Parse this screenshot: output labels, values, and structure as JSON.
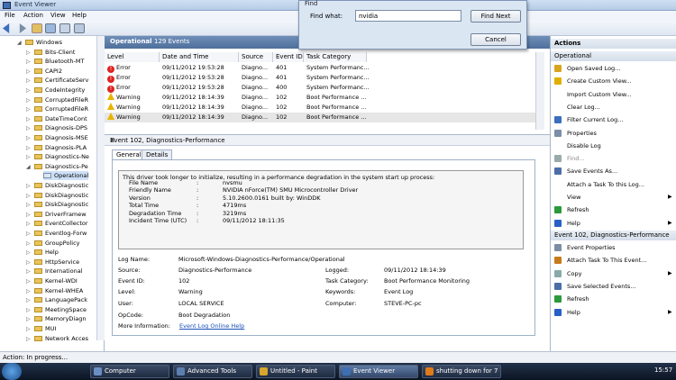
{
  "window": {
    "title": "Event Viewer"
  },
  "menu": [
    "File",
    "Action",
    "View",
    "Help"
  ],
  "tree": {
    "items": [
      {
        "label": "Windows",
        "level": 0,
        "expanded": true
      },
      {
        "label": "Bits-Client",
        "level": 1
      },
      {
        "label": "Bluetooth-MT",
        "level": 1
      },
      {
        "label": "CAPI2",
        "level": 1
      },
      {
        "label": "CertificateServ",
        "level": 1
      },
      {
        "label": "CodeIntegrity",
        "level": 1
      },
      {
        "label": "CorruptedFileR",
        "level": 1
      },
      {
        "label": "CorruptedFileR",
        "level": 1
      },
      {
        "label": "DateTimeCont",
        "level": 1
      },
      {
        "label": "Diagnosis-DPS",
        "level": 1
      },
      {
        "label": "Diagnosis-MSE",
        "level": 1
      },
      {
        "label": "Diagnosis-PLA",
        "level": 1
      },
      {
        "label": "Diagnostics-Ne",
        "level": 1
      },
      {
        "label": "Diagnostics-Pe",
        "level": 1,
        "expanded": true
      },
      {
        "label": "Operational",
        "level": 2,
        "selected": true
      },
      {
        "label": "DiskDiagnostic",
        "level": 1
      },
      {
        "label": "DiskDiagnostic",
        "level": 1
      },
      {
        "label": "DiskDiagnostic",
        "level": 1
      },
      {
        "label": "DriverFramew",
        "level": 1
      },
      {
        "label": "EventCollector",
        "level": 1
      },
      {
        "label": "Eventlog-Forw",
        "level": 1
      },
      {
        "label": "GroupPolicy",
        "level": 1
      },
      {
        "label": "Help",
        "level": 1
      },
      {
        "label": "HttpService",
        "level": 1
      },
      {
        "label": "International",
        "level": 1
      },
      {
        "label": "Kernel-WDI",
        "level": 1
      },
      {
        "label": "Kernel-WHEA",
        "level": 1
      },
      {
        "label": "LanguagePack",
        "level": 1
      },
      {
        "label": "MeetingSpace",
        "level": 1
      },
      {
        "label": "MemoryDiagn",
        "level": 1
      },
      {
        "label": "MUI",
        "level": 1
      },
      {
        "label": "Network Acces",
        "level": 1
      }
    ]
  },
  "log": {
    "name": "Operational",
    "count": "129 Events"
  },
  "columns": [
    "Level",
    "Date and Time",
    "Source",
    "Event ID",
    "Task Category"
  ],
  "events": [
    {
      "level": "Error",
      "type": "error",
      "date": "09/11/2012 19:53:28",
      "source": "Diagno...",
      "id": "401",
      "task": "System Performanc..."
    },
    {
      "level": "Error",
      "type": "error",
      "date": "09/11/2012 19:53:28",
      "source": "Diagno...",
      "id": "401",
      "task": "System Performanc..."
    },
    {
      "level": "Error",
      "type": "error",
      "date": "09/11/2012 19:53:28",
      "source": "Diagno...",
      "id": "400",
      "task": "System Performanc..."
    },
    {
      "level": "Warning",
      "type": "warning",
      "date": "09/11/2012 18:14:39",
      "source": "Diagno...",
      "id": "102",
      "task": "Boot Performance ..."
    },
    {
      "level": "Warning",
      "type": "warning",
      "date": "09/11/2012 18:14:39",
      "source": "Diagno...",
      "id": "102",
      "task": "Boot Performance ..."
    },
    {
      "level": "Warning",
      "type": "warning",
      "date": "09/11/2012 18:14:39",
      "source": "Diagno...",
      "id": "102",
      "task": "Boot Performance ..."
    }
  ],
  "detail": {
    "title": "Event 102, Diagnostics-Performance",
    "tabs": [
      "General",
      "Details"
    ],
    "description": "This driver took longer to initialize, resulting in a performance degradation in the system start up process:",
    "fields": [
      {
        "k": "File Name",
        "v": "nvsmu"
      },
      {
        "k": "Friendly Name",
        "v": "NVIDIA nForce(TM) SMU Microcontroller Driver"
      },
      {
        "k": "Version",
        "v": "5.10.2600.0161 built by: WinDDK"
      },
      {
        "k": "Total Time",
        "v": "4719ms"
      },
      {
        "k": "Degradation Time",
        "v": "3219ms"
      },
      {
        "k": "Incident Time (UTC)",
        "v": "09/11/2012 18:11:35"
      }
    ],
    "log_name_label": "Log Name:",
    "log_name": "Microsoft-Windows-Diagnostics-Performance/Operational",
    "source_label": "Source:",
    "source": "Diagnostics-Performance",
    "logged_label": "Logged:",
    "logged": "09/11/2012 18:14:39",
    "event_id_label": "Event ID:",
    "event_id": "102",
    "task_label": "Task Category:",
    "task": "Boot Performance Monitoring",
    "level_label": "Level:",
    "level": "Warning",
    "keywords_label": "Keywords:",
    "keywords": "Event Log",
    "user_label": "User:",
    "user": "LOCAL SERVICE",
    "computer_label": "Computer:",
    "computer": "STEVE-PC-pc",
    "opcode_label": "OpCode:",
    "opcode": "Boot Degradation",
    "more_label": "More Information:",
    "more_link": "Event Log Online Help"
  },
  "actions": {
    "header": "Actions",
    "section1": "Operational",
    "items1": [
      {
        "label": "Open Saved Log...",
        "icon": "folder-open-icon",
        "color": "#d9a520"
      },
      {
        "label": "Create Custom View...",
        "icon": "filter-icon",
        "color": "#e0b000"
      },
      {
        "label": "Import Custom View...",
        "icon": "",
        "color": ""
      },
      {
        "label": "Clear Log...",
        "icon": "",
        "color": ""
      },
      {
        "label": "Filter Current Log...",
        "icon": "filter-icon",
        "color": "#3a6fc0"
      },
      {
        "label": "Properties",
        "icon": "properties-icon",
        "color": "#7a8ea8"
      },
      {
        "label": "Disable Log",
        "icon": "",
        "color": ""
      },
      {
        "label": "Find...",
        "icon": "find-icon",
        "color": "#9aa"
      },
      {
        "label": "Save Events As...",
        "icon": "save-icon",
        "color": "#4b6ea8"
      },
      {
        "label": "Attach a Task To this Log...",
        "icon": "",
        "color": ""
      },
      {
        "label": "View",
        "icon": "",
        "color": "",
        "submenu": true
      },
      {
        "label": "Refresh",
        "icon": "refresh-icon",
        "color": "#2a9a3a"
      },
      {
        "label": "Help",
        "icon": "help-icon",
        "color": "#2860c8",
        "submenu": true
      }
    ],
    "section2": "Event 102, Diagnostics-Performance",
    "items2": [
      {
        "label": "Event Properties",
        "icon": "properties-icon",
        "color": "#7a8ea8"
      },
      {
        "label": "Attach Task To This Event...",
        "icon": "task-icon",
        "color": "#c77a1a"
      },
      {
        "label": "Copy",
        "icon": "copy-icon",
        "color": "#8aa",
        "submenu": true
      },
      {
        "label": "Save Selected Events...",
        "icon": "save-icon",
        "color": "#4b6ea8"
      },
      {
        "label": "Refresh",
        "icon": "refresh-icon",
        "color": "#2a9a3a"
      },
      {
        "label": "Help",
        "icon": "help-icon",
        "color": "#2860c8",
        "submenu": true
      }
    ]
  },
  "find_dialog": {
    "title": "Find",
    "label": "Find what:",
    "value": "nvidia",
    "find_next": "Find Next",
    "cancel": "Cancel"
  },
  "status": "Action:  In progress...",
  "taskbar": {
    "items": [
      {
        "label": "Computer",
        "color": "#6a8fc4"
      },
      {
        "label": "Advanced Tools",
        "color": "#5c7fb0"
      },
      {
        "label": "Untitled - Paint",
        "color": "#d8a62c"
      },
      {
        "label": "Event Viewer",
        "color": "#3f6fb3",
        "active": true
      },
      {
        "label": "shutting down for 7 ...",
        "color": "#e07a1a"
      }
    ],
    "clock": "15:57"
  }
}
